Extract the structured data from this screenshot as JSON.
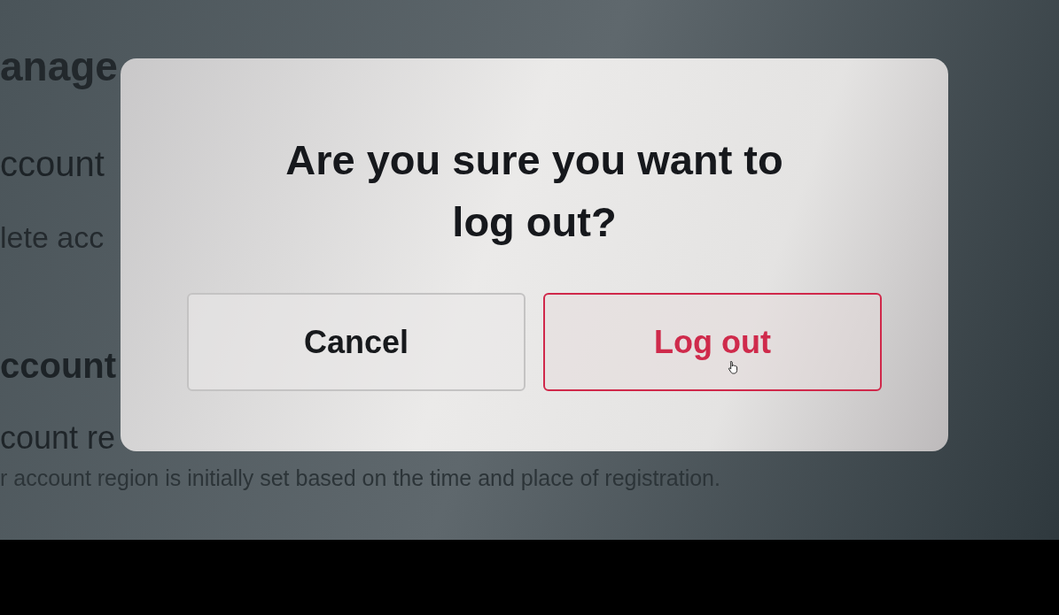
{
  "background": {
    "heading": "anage",
    "lines": [
      {
        "kind": "section",
        "text": "ccount"
      },
      {
        "kind": "link",
        "text": "lete acc"
      },
      {
        "kind": "section",
        "text": "ccount"
      },
      {
        "kind": "label",
        "text": "count re"
      },
      {
        "kind": "hint",
        "text": "r account region is initially set based on the time and place of registration."
      }
    ]
  },
  "dialog": {
    "title": "Are you sure you want to log out?",
    "buttons": [
      {
        "label": "Cancel",
        "kind": "neutral"
      },
      {
        "label": "Log out",
        "kind": "danger"
      }
    ]
  }
}
